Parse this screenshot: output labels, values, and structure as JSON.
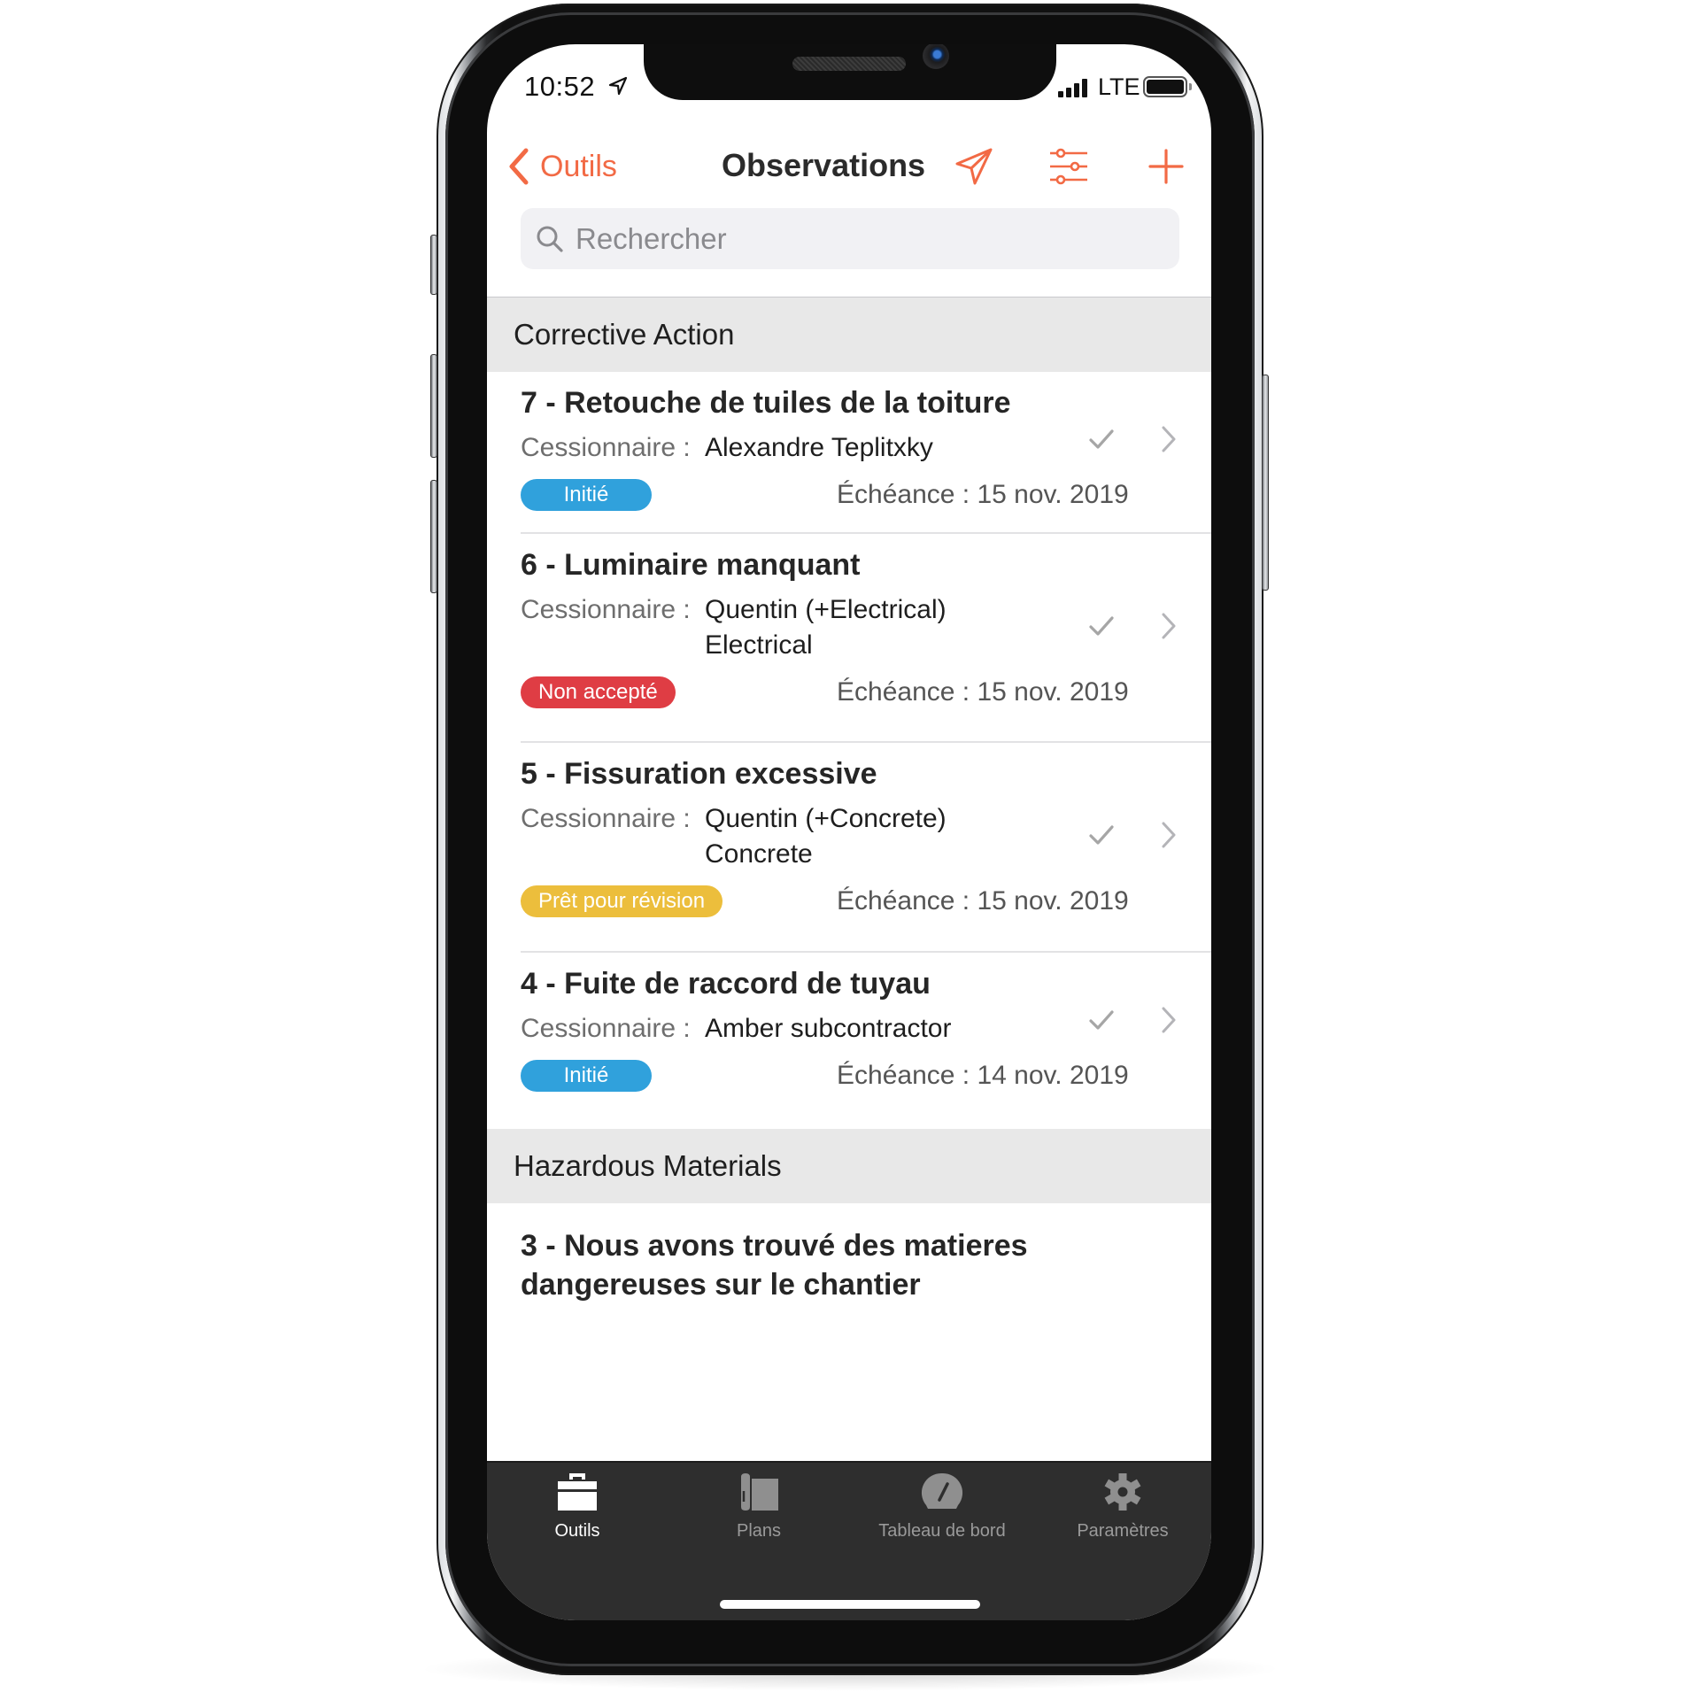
{
  "status_bar": {
    "time": "10:52",
    "location_icon": "location-arrow-icon",
    "network": "LTE",
    "signal_icon": "cellular-signal-icon",
    "battery_icon": "battery-full-icon"
  },
  "nav": {
    "back_label": "Outils",
    "back_icon": "chevron-left-icon",
    "title": "Observations",
    "actions": [
      {
        "name": "send",
        "icon": "paper-plane-icon"
      },
      {
        "name": "filter",
        "icon": "sliders-icon"
      },
      {
        "name": "add",
        "icon": "plus-icon"
      }
    ]
  },
  "search": {
    "placeholder": "Rechercher",
    "value": "",
    "icon": "search-icon"
  },
  "colors": {
    "accent": "#F26A45",
    "status_initie": "#30A1DC",
    "status_non_accepte": "#DF3D44",
    "status_pret_revision": "#ECBE3C",
    "section_header_bg": "#E8E8E8",
    "tabbar_bg": "#2E2E2E"
  },
  "sections": [
    {
      "title": "Corrective Action",
      "items": [
        {
          "title": "7 - Retouche de tuiles de la toiture",
          "assignee_label": "Cessionnaire :",
          "assignee": "Alexandre Teplitxky",
          "assignee_line2": "",
          "status": "Initié",
          "due": "Échéance : 15 nov. 2019"
        },
        {
          "title": "6 - Luminaire manquant",
          "assignee_label": "Cessionnaire :",
          "assignee": "Quentin (+Electrical)",
          "assignee_line2": "Electrical",
          "status": "Non accepté",
          "due": "Échéance : 15 nov. 2019"
        },
        {
          "title": "5 - Fissuration excessive",
          "assignee_label": "Cessionnaire :",
          "assignee": "Quentin (+Concrete)",
          "assignee_line2": "Concrete",
          "status": "Prêt pour révision",
          "due": "Échéance : 15 nov. 2019"
        },
        {
          "title": "4 - Fuite de raccord de tuyau",
          "assignee_label": "Cessionnaire :",
          "assignee": "Amber subcontractor",
          "assignee_line2": "",
          "status": "Initié",
          "due": "Échéance : 14 nov. 2019"
        }
      ]
    },
    {
      "title": "Hazardous Materials",
      "items": [
        {
          "title_line1": "3 - Nous avons trouvé des matieres",
          "title_line2": "dangereuses sur le chantier"
        }
      ]
    }
  ],
  "tabbar": {
    "tabs": [
      {
        "label": "Outils",
        "icon": "toolbox-icon",
        "active": true
      },
      {
        "label": "Plans",
        "icon": "blueprint-icon",
        "active": false
      },
      {
        "label": "Tableau de bord",
        "icon": "dashboard-gauge-icon",
        "active": false
      },
      {
        "label": "Paramètres",
        "icon": "gear-icon",
        "active": false
      }
    ]
  }
}
